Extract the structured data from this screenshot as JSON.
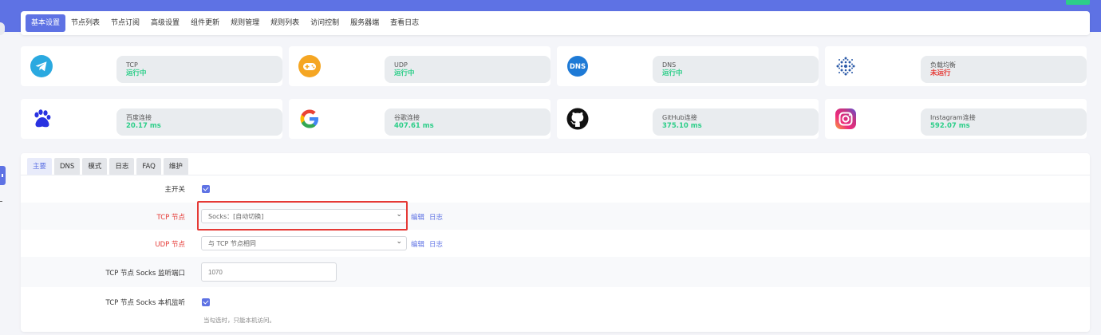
{
  "colors": {
    "primary": "#5e72e4",
    "success": "#2dce89",
    "danger": "#e53935",
    "highlight": "#e53935"
  },
  "nav": {
    "tabs": [
      {
        "label": "基本设置"
      },
      {
        "label": "节点列表"
      },
      {
        "label": "节点订阅"
      },
      {
        "label": "高级设置"
      },
      {
        "label": "组件更新"
      },
      {
        "label": "规则管理"
      },
      {
        "label": "规则列表"
      },
      {
        "label": "访问控制"
      },
      {
        "label": "服务器端"
      },
      {
        "label": "查看日志"
      }
    ]
  },
  "status": {
    "cards": [
      {
        "icon": "telegram-icon",
        "label": "TCP",
        "value": "运行中",
        "value_color": "#2dce89"
      },
      {
        "icon": "gamepad-icon",
        "label": "UDP",
        "value": "运行中",
        "value_color": "#2dce89"
      },
      {
        "icon": "dns-icon",
        "icon_text": "DNS",
        "label": "DNS",
        "value": "运行中",
        "value_color": "#2dce89"
      },
      {
        "icon": "load-balance-icon",
        "label": "负载均衡",
        "value": "未运行",
        "value_color": "#e53935"
      },
      {
        "icon": "baidu-paw-icon",
        "label": "百度连接",
        "value": "20.17 ms",
        "value_color": "#2dce89"
      },
      {
        "icon": "google-icon",
        "label": "谷歌连接",
        "value": "407.61 ms",
        "value_color": "#2dce89"
      },
      {
        "icon": "github-icon",
        "label": "GitHub连接",
        "value": "375.10 ms",
        "value_color": "#2dce89"
      },
      {
        "icon": "instagram-icon",
        "label": "Instagram连接",
        "value": "592.07 ms",
        "value_color": "#2dce89"
      }
    ]
  },
  "settings": {
    "subtabs": [
      {
        "label": "主要"
      },
      {
        "label": "DNS"
      },
      {
        "label": "模式"
      },
      {
        "label": "日志"
      },
      {
        "label": "FAQ"
      },
      {
        "label": "维护"
      }
    ],
    "main_switch": {
      "label": "主开关",
      "checked": true
    },
    "tcp_node": {
      "label": "TCP 节点",
      "value": "Socks：[自动切换]",
      "edit": "编辑",
      "log": "日志"
    },
    "udp_node": {
      "label": "UDP 节点",
      "value": "与 TCP 节点相同",
      "edit": "编辑",
      "log": "日志"
    },
    "socks_port": {
      "label": "TCP 节点 Socks 监听端口",
      "placeholder": "1070"
    },
    "socks_local": {
      "label": "TCP 节点 Socks 本机监听",
      "checked": true,
      "hint": "当勾选时，只能本机访问。"
    }
  }
}
